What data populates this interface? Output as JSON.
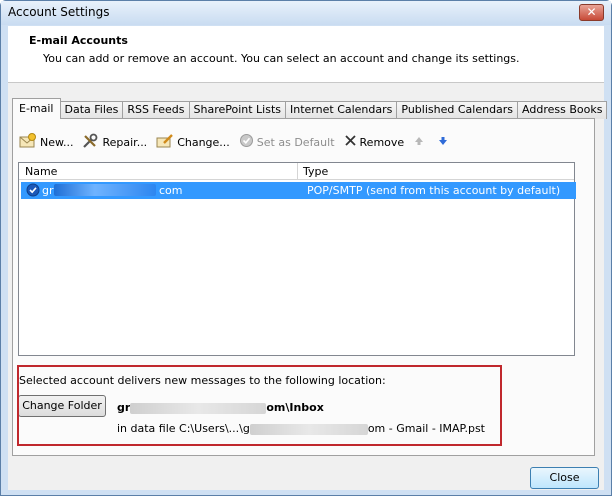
{
  "window": {
    "title": "Account Settings",
    "close_glyph": "✕"
  },
  "header": {
    "title": "E-mail Accounts",
    "description": "You can add or remove an account. You can select an account and change its settings."
  },
  "tabs": [
    {
      "label": "E-mail",
      "active": true
    },
    {
      "label": "Data Files"
    },
    {
      "label": "RSS Feeds"
    },
    {
      "label": "SharePoint Lists"
    },
    {
      "label": "Internet Calendars"
    },
    {
      "label": "Published Calendars"
    },
    {
      "label": "Address Books"
    }
  ],
  "toolbar": {
    "new_label": "New...",
    "repair_label": "Repair...",
    "change_label": "Change...",
    "set_default_label": "Set as Default",
    "remove_label": "Remove"
  },
  "accounts": {
    "col_name": "Name",
    "col_type": "Type",
    "rows": [
      {
        "name_prefix": "gr",
        "name_suffix": "com",
        "type": "POP/SMTP (send from this account by default)"
      }
    ]
  },
  "delivery": {
    "label": "Selected account delivers new messages to the following location:",
    "change_folder_label": "Change Folder",
    "path_prefix": "gr",
    "path_suffix": "om\\Inbox",
    "file_prefix": "in data file C:\\Users\\...\\g",
    "file_suffix": "om - Gmail - IMAP.pst"
  },
  "footer": {
    "close_label": "Close"
  },
  "colors": {
    "selection": "#3399ff",
    "highlight_border": "#c0282d",
    "arrow_blue": "#2f6bd8"
  }
}
